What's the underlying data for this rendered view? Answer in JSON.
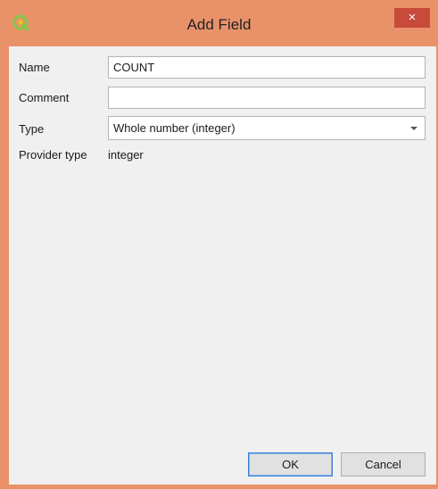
{
  "window": {
    "title": "Add Field",
    "close_label": "×",
    "app_icon": "qgis-icon",
    "title_bar_color": "#e9926a"
  },
  "form": {
    "name_label": "Name",
    "name_value": "COUNT",
    "comment_label": "Comment",
    "comment_value": "",
    "type_label": "Type",
    "type_value": "Whole number (integer)",
    "provider_type_label": "Provider type",
    "provider_type_value": "integer"
  },
  "buttons": {
    "ok_label": "OK",
    "cancel_label": "Cancel"
  }
}
